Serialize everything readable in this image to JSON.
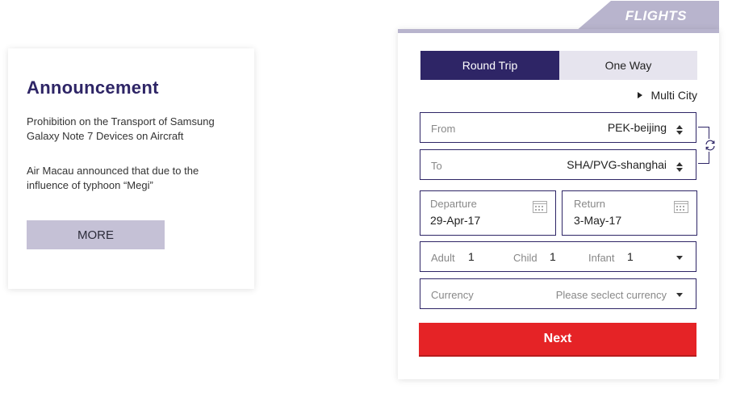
{
  "announcement": {
    "title": "Announcement",
    "item1": "Prohibition on the Transport of Samsung Galaxy Note 7 Devices on Aircraft",
    "item2": "Air Macau announced that due to the influence of typhoon “Megi”",
    "more_label": "MORE"
  },
  "flights": {
    "tab_label": "FLIGHTS",
    "round_trip": "Round Trip",
    "one_way": "One Way",
    "multi_city": "Multi City",
    "from": {
      "label": "From",
      "value": "PEK-beijing"
    },
    "to": {
      "label": "To",
      "value": "SHA/PVG-shanghai"
    },
    "departure": {
      "label": "Departure",
      "value": "29-Apr-17"
    },
    "return": {
      "label": "Return",
      "value": "3-May-17"
    },
    "passengers": {
      "adult_label": "Adult",
      "adult_value": "1",
      "child_label": "Child",
      "child_value": "1",
      "infant_label": "Infant",
      "infant_value": "1"
    },
    "currency": {
      "label": "Currency",
      "placeholder": "Please seclect currency"
    },
    "next_label": "Next"
  },
  "colors": {
    "primary": "#2e2566",
    "accent_light": "#b8b4cd",
    "more_button": "#c5c1d6",
    "next_button": "#e52326"
  },
  "icons": [
    "caret-right-icon",
    "updown-arrows-icon",
    "swap-icon",
    "calendar-icon",
    "chevron-down-icon"
  ]
}
